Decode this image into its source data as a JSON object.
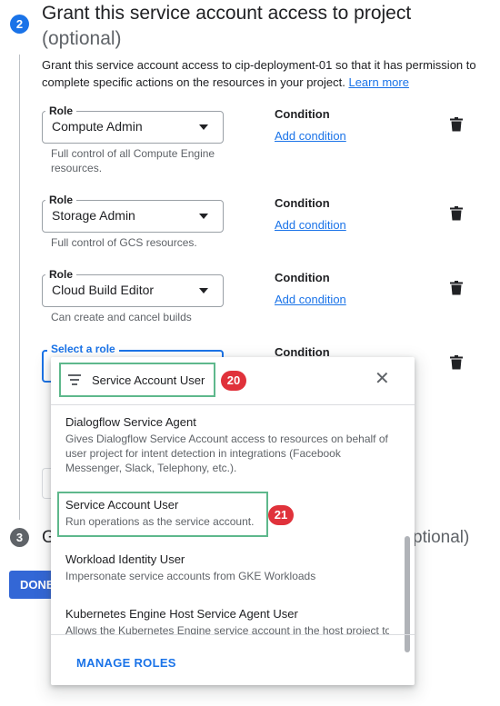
{
  "step2": {
    "number": "2",
    "title": "Grant this service account access to project",
    "subtitle": "(optional)",
    "description": "Grant this service account access to cip-deployment-01 so that it has permission to complete specific actions on the resources in your project.",
    "learn_more": "Learn more"
  },
  "roles": [
    {
      "label": "Role",
      "value": "Compute Admin",
      "helper": "Full control of all Compute Engine resources.",
      "condition_label": "Condition",
      "add_condition": "Add condition"
    },
    {
      "label": "Role",
      "value": "Storage Admin",
      "helper": "Full control of GCS resources.",
      "condition_label": "Condition",
      "add_condition": "Add condition"
    },
    {
      "label": "Role",
      "value": "Cloud Build Editor",
      "helper": "Can create and cancel builds",
      "condition_label": "Condition",
      "add_condition": "Add condition"
    }
  ],
  "active_role": {
    "label": "Select a role",
    "condition_label": "Condition"
  },
  "step3": {
    "number": "3",
    "title_start": "G",
    "title_end": "ptional)"
  },
  "done_button": "DONE",
  "dropdown": {
    "filter_value": "Service Account User",
    "items": [
      {
        "name": "Dialogflow Service Agent",
        "description": "Gives Dialogflow Service Account access to resources on behalf of user project for intent detection in integrations (Facebook Messenger, Slack, Telephony, etc.)."
      },
      {
        "name": "Service Account User",
        "description": "Run operations as the service account."
      },
      {
        "name": "Workload Identity User",
        "description": "Impersonate service accounts from GKE Workloads"
      },
      {
        "name": "Kubernetes Engine Host Service Agent User",
        "description": "Allows the Kubernetes Engine service account in the host project to"
      }
    ],
    "manage_roles": "MANAGE ROLES"
  },
  "badges": [
    "20",
    "21"
  ],
  "colors": {
    "accent": "#1a73e8",
    "highlight": "#5eb88c",
    "badge": "#e0323b"
  }
}
